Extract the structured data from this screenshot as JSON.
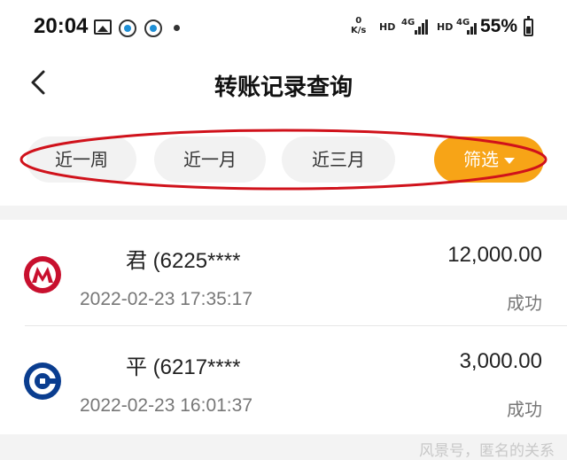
{
  "status_bar": {
    "time": "20:04",
    "net_speed_value": "0",
    "net_speed_unit": "K/s",
    "hd_label": "HD",
    "network_label": "4G",
    "battery": "55%"
  },
  "header": {
    "title": "转账记录查询"
  },
  "filters": {
    "week": "近一周",
    "month": "近一月",
    "three_months": "近三月",
    "filter_button": "筛选",
    "accent_color": "#f7a417",
    "annotation_color": "#d0121b"
  },
  "records": [
    {
      "bank_icon": "cmb-bank-icon",
      "bank_color": "#c8102e",
      "name": "君 (6225****",
      "time": "2022-02-23 17:35:17",
      "amount": "12,000.00",
      "status": "成功"
    },
    {
      "bank_icon": "ccb-bank-icon",
      "bank_color": "#0a3d8f",
      "name": "平 (6217****",
      "time": "2022-02-23 16:01:37",
      "amount": "3,000.00",
      "status": "成功"
    }
  ],
  "watermark": "风景号，匿名的关系"
}
